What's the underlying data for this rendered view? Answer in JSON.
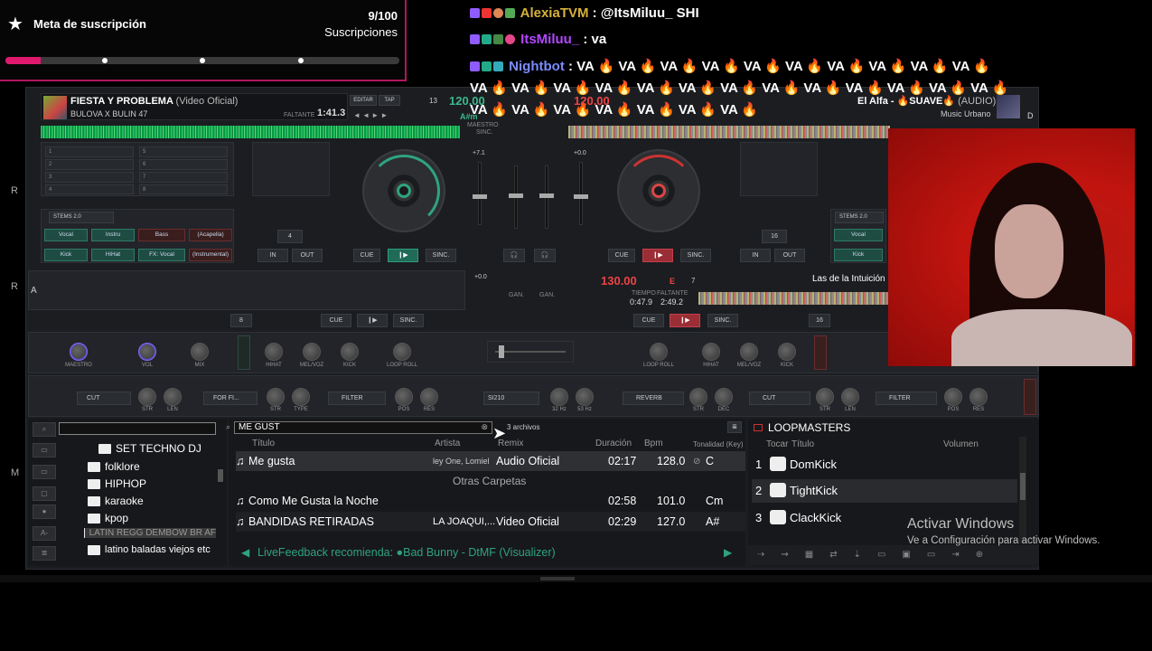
{
  "goal": {
    "title": "Meta de suscripción",
    "count": "9/100",
    "label": "Suscripciones",
    "progress": 0.09
  },
  "chat": [
    {
      "user": "AlexiaTVM",
      "user_color": "#d6b13a",
      "message": " : @ItsMiluu_ SHI",
      "mention_color": "#9aa0ff"
    },
    {
      "user": "ItsMiluu_",
      "user_color": "#b347ff",
      "message": " : va"
    },
    {
      "user": "Nightbot",
      "user_color": "#7b8cff",
      "message": " : VA 🔥 VA 🔥 VA 🔥 VA 🔥 VA 🔥 VA 🔥 VA 🔥 VA 🔥 VA 🔥 VA 🔥"
    },
    {
      "message": "VA 🔥 VA 🔥 VA 🔥 VA 🔥 VA 🔥 VA 🔥 VA 🔥 VA 🔥 VA 🔥 VA 🔥 VA 🔥 VA 🔥 VA 🔥"
    },
    {
      "message": "VA 🔥 VA 🔥 VA 🔥 VA 🔥 VA 🔥 VA 🔥 VA 🔥"
    }
  ],
  "deck_left": {
    "title": "FIESTA Y PROBLEMA",
    "title_sub": "(Video Oficial)",
    "artist": "BULOVA X BULIN 47",
    "remaining_label": "FALTANTE",
    "time": "1:41.3",
    "edit": "EDITAR",
    "tap": "TAP",
    "bpm": "120.00",
    "key_num": "13",
    "key": "A#m",
    "master": "MAESTRO",
    "sync_small": "SINC.",
    "pitch": "+7.1",
    "cue": "CUE",
    "sync": "SINC.",
    "stems": "STEMS 2.0",
    "stem_buttons": [
      "Vocal",
      "Instru",
      "Bass",
      "(Acapella)",
      "Kick",
      "HiHat",
      "FX: Vocal",
      "(Instrumental)"
    ],
    "loop_size": "4",
    "in": "IN",
    "out": "OUT"
  },
  "deck_right": {
    "title": "El Alfa - 🔥SUAVE🔥",
    "title_sub": "(AUDIO)",
    "genre": "Music Urbano",
    "letter": "D",
    "bpm": "120.00",
    "cue": "CUE",
    "sync": "SINC.",
    "stems": "STEMS 2.0",
    "stem_buttons": [
      "Vocal",
      "Kick"
    ],
    "loop_size": "16",
    "in": "IN",
    "out": "OUT",
    "pitch": "+0.0"
  },
  "deck_b": {
    "letter": "A",
    "loop_size": "8",
    "cue": "CUE",
    "sync": "SINC.",
    "pitch": "+0.0"
  },
  "deck_c": {
    "bpm": "130.00",
    "key": "E",
    "key_num": "7",
    "time_label": "TIEMPO",
    "time": "0:47.9",
    "remaining_label": "FALTANTE",
    "remaining": "2:49.2",
    "title": "Las de la Intuición",
    "cue": "CUE",
    "sync": "SINC.",
    "loop_size": "16",
    "gain": "GAN."
  },
  "fx_row": {
    "left_knobs": [
      "MAESTRO",
      "VOL",
      "MIX",
      "HIHAT",
      "MEL/VOZ",
      "KICK",
      "LOOP ROLL"
    ],
    "right_knobs": [
      "LOOP ROLL",
      "HIHAT",
      "MEL/VOZ",
      "KICK"
    ],
    "left_fx": [
      "CUT",
      "STR",
      "LEN",
      "FOR FI...",
      "STR",
      "TYPE",
      "FILTER",
      "POS",
      "RES"
    ],
    "center_fx": [
      "SI210",
      "32 Hz",
      "53 Hz"
    ],
    "right_fx": [
      "REVERB",
      "STR",
      "DEC",
      "CUT",
      "STR",
      "LEN",
      "FILTER",
      "POS",
      "RES"
    ]
  },
  "browser": {
    "folders": [
      "SET TECHNO DJ",
      "folklore",
      "HIPHOP",
      "karaoke",
      "kpop",
      "LATIN REGG DEMBOW BR AF",
      "latino baladas viejos etc"
    ],
    "search_query": "ME GUST",
    "result_count": "3 archivos",
    "columns": [
      "Título",
      "Artista",
      "Remix",
      "Duración",
      "Bpm",
      "Tonalidad (Key)"
    ],
    "rows": [
      {
        "title": "Me gusta",
        "artist": "ley One, Lomiel",
        "remix": "Audio Oficial",
        "duration": "02:17",
        "bpm": "128.0",
        "key": "C"
      }
    ],
    "other_folders_label": "Otras Carpetas",
    "other_rows": [
      {
        "title": "Como Me Gusta la Noche",
        "artist": "",
        "remix": "",
        "duration": "02:58",
        "bpm": "101.0",
        "key": "Cm"
      },
      {
        "title": "BANDIDAS RETIRADAS",
        "artist": "LA JOAQUI,...",
        "remix": "Video Oficial",
        "duration": "02:29",
        "bpm": "127.0",
        "key": "A#"
      }
    ],
    "feedback": "LiveFeedback recomienda: ●Bad Bunny - DtMF (Visualizer)"
  },
  "loopmasters": {
    "title": "LOOPMASTERS",
    "columns": [
      "Tocar",
      "Título",
      "Volumen"
    ],
    "items": [
      {
        "num": "1",
        "name": "DomKick"
      },
      {
        "num": "2",
        "name": "TightKick"
      },
      {
        "num": "3",
        "name": "ClackKick"
      }
    ]
  },
  "windows_watermark": {
    "title": "Activar Windows",
    "subtitle": "Ve a Configuración para activar Windows."
  },
  "colors": {
    "accent_green": "#2fa37e",
    "accent_red": "#c2404a",
    "goal_border": "#b0175f",
    "goal_bar": "#e0196e"
  }
}
